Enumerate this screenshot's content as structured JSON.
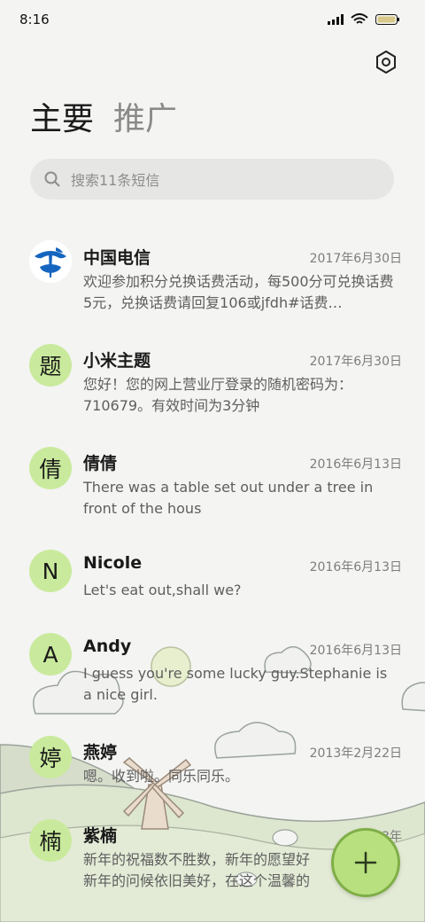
{
  "status_bar": {
    "time": "8:16"
  },
  "tabs": [
    {
      "label": "主要",
      "active": true
    },
    {
      "label": "推广",
      "active": false
    }
  ],
  "search": {
    "placeholder": "搜索11条短信"
  },
  "messages": [
    {
      "name": "中国电信",
      "date": "2017年6月30日",
      "preview": "欢迎参加积分兑换话费活动，每500分可兑换话费5元，兑换话费请回复106或jfdh#话费…",
      "avatar": "",
      "avatar_icon": "china-telecom-logo-icon"
    },
    {
      "name": "小米主题",
      "date": "2017年6月30日",
      "preview": "您好！您的网上营业厅登录的随机密码为：710679。有效时间为3分钟",
      "avatar": "题"
    },
    {
      "name": "倩倩",
      "date": "2016年6月13日",
      "preview": "There was a table set out under a tree in front of the hous",
      "avatar": "倩"
    },
    {
      "name": "Nicole",
      "date": "2016年6月13日",
      "preview": "Let's eat out,shall we?",
      "avatar": "N"
    },
    {
      "name": "Andy",
      "date": "2016年6月13日",
      "preview": "I guess you're some lucky guy.Stephanie is a nice girl.",
      "avatar": "A"
    },
    {
      "name": "燕婷",
      "date": "2013年2月22日",
      "preview": "嗯。收到啦。同乐同乐。",
      "avatar": "婷"
    },
    {
      "name": "紫楠",
      "date": "2013年",
      "preview": "新年的祝福数不胜数，新年的愿望好新年的问候依旧美好，在这个温馨的",
      "avatar": "楠"
    }
  ],
  "fab": {
    "icon": "plus-icon"
  },
  "colors": {
    "avatar_bg": "#c9ea9c",
    "fab_bg": "#b9e07e",
    "page_bg": "#f4f4f2"
  }
}
